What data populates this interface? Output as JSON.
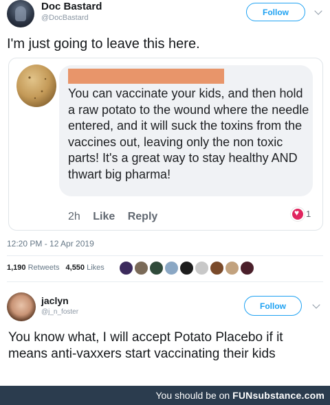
{
  "tweet1": {
    "name": "Doc Bastard",
    "handle": "@DocBastard",
    "follow_label": "Follow",
    "text": "I'm just going to leave this here.",
    "embedded_post": {
      "body": "You can vaccinate your kids, and then hold a raw potato to the wound where the needle entered, and it will suck the toxins from the vaccines out, leaving only the non toxic parts! It's a great way to stay healthy AND thwart big pharma!",
      "time": "2h",
      "like_label": "Like",
      "reply_label": "Reply",
      "reaction_count": "1"
    },
    "timestamp": "12:20 PM - 12 Apr 2019",
    "retweets_count": "1,190",
    "retweets_label": "Retweets",
    "likes_count": "4,550",
    "likes_label": "Likes",
    "liker_avatar_colors": [
      "#3b2a5c",
      "#7a6a58",
      "#2f4a3a",
      "#8aa7c4",
      "#1d1d1d",
      "#c8c8c8",
      "#7a4a2a",
      "#c2a27e",
      "#4a1f2a"
    ]
  },
  "tweet2": {
    "name": "jaclyn",
    "handle": "@j_n_foster",
    "follow_label": "Follow",
    "text": "You know what, I will accept Potato Placebo if it means anti-vaxxers start vaccinating their kids"
  },
  "footer": {
    "prefix": "You should be on",
    "brand": "FUNsubstance.com"
  },
  "colors": {
    "accent": "#1da1f2",
    "heart": "#e0245e",
    "redaction": "#e8956a",
    "footer_bg": "#2b3c4e"
  }
}
